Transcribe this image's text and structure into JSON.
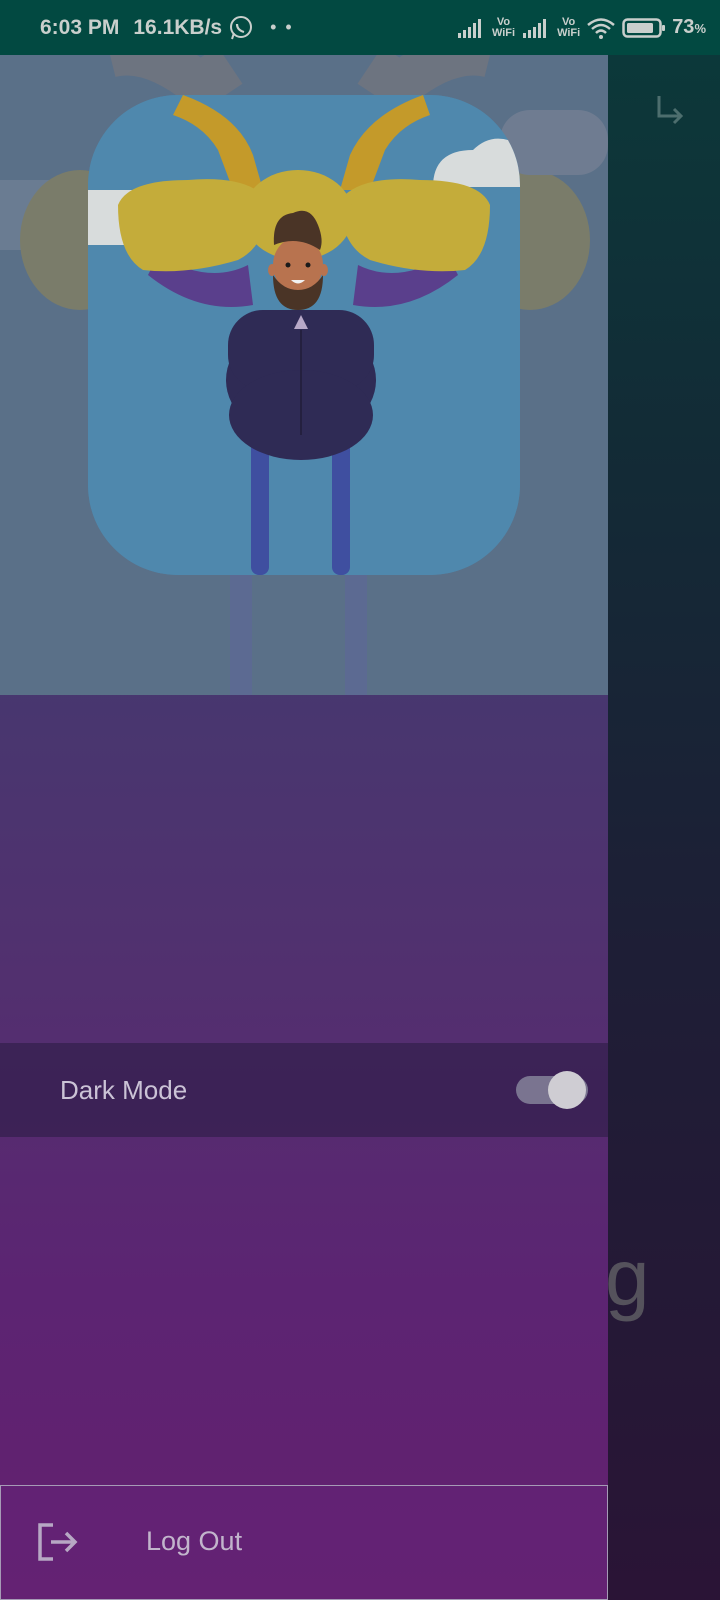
{
  "status_bar": {
    "time": "6:03 PM",
    "speed": "16.1KB/s",
    "dots": "• •",
    "volte_1": [
      "Vo",
      "WiFi"
    ],
    "volte_2": [
      "Vo",
      "WiFi"
    ],
    "battery": "73",
    "battery_unit": "%"
  },
  "background": {
    "partial_text": "g"
  },
  "drawer": {
    "dark_mode": {
      "label": "Dark Mode",
      "enabled": true
    },
    "logout": {
      "label": "Log Out"
    }
  },
  "icons": {
    "whatsapp": "whatsapp-icon",
    "signal": "signal-icon",
    "wifi": "wifi-icon",
    "battery": "battery-icon",
    "subdirectory_arrow": "subdirectory-arrow-icon",
    "logout": "logout-icon"
  }
}
